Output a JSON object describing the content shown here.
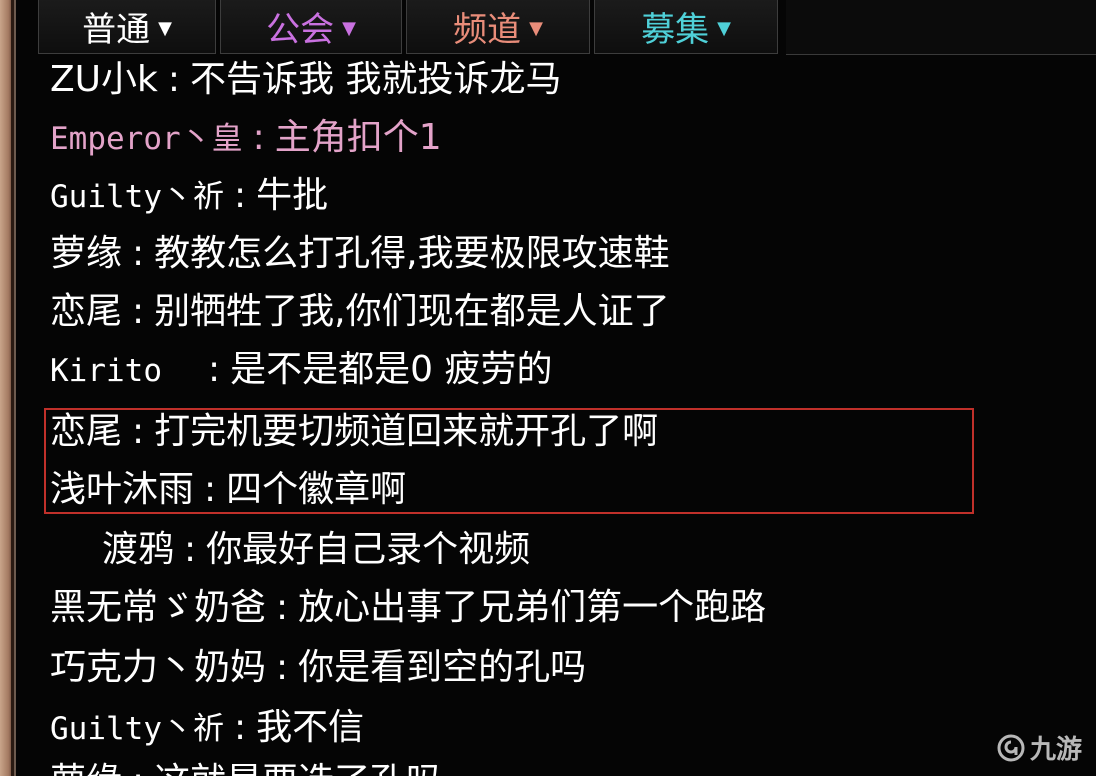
{
  "tabs": [
    {
      "label": "普通",
      "color": "#ffffff"
    },
    {
      "label": "公会",
      "color": "#c971e0"
    },
    {
      "label": "频道",
      "color": "#e98d7a"
    },
    {
      "label": "募集",
      "color": "#4fd0d8"
    }
  ],
  "tab_caret": "▼",
  "messages": [
    {
      "name": "ZU小k",
      "text": "不告诉我 我就投诉龙马"
    },
    {
      "name": "Emperor丶皇",
      "text": "主角扣个1"
    },
    {
      "name": "Guilty丶祈",
      "text": "牛批"
    },
    {
      "name": "萝缘",
      "text": "教教怎么打孔得,我要极限攻速鞋"
    },
    {
      "name": "恋尾",
      "text": "别牺牲了我,你们现在都是人证了"
    },
    {
      "name": "Kirito",
      "text": "是不是都是0 疲劳的"
    },
    {
      "name": "恋尾",
      "text": "打完机要切频道回来就开孔了啊"
    },
    {
      "name": "浅叶沐雨",
      "text": "四个徽章啊"
    },
    {
      "name": "渡鸦",
      "text": "你最好自己录个视频"
    },
    {
      "name": "黑无常ゞ奶爸",
      "text": "放心出事了兄弟们第一个跑路"
    },
    {
      "name": "巧克力丶奶妈",
      "text": "你是看到空的孔吗"
    },
    {
      "name": "Guilty丶祈",
      "text": "我不信"
    },
    {
      "name": "萝缘",
      "text": "这就是要选了孔吗"
    }
  ],
  "separator": ":",
  "watermark": {
    "text": "九游",
    "icon": "nine-game-logo-icon"
  },
  "colors": {
    "highlight_border": "#c0302a",
    "pink_message": "#e3a3c9"
  }
}
